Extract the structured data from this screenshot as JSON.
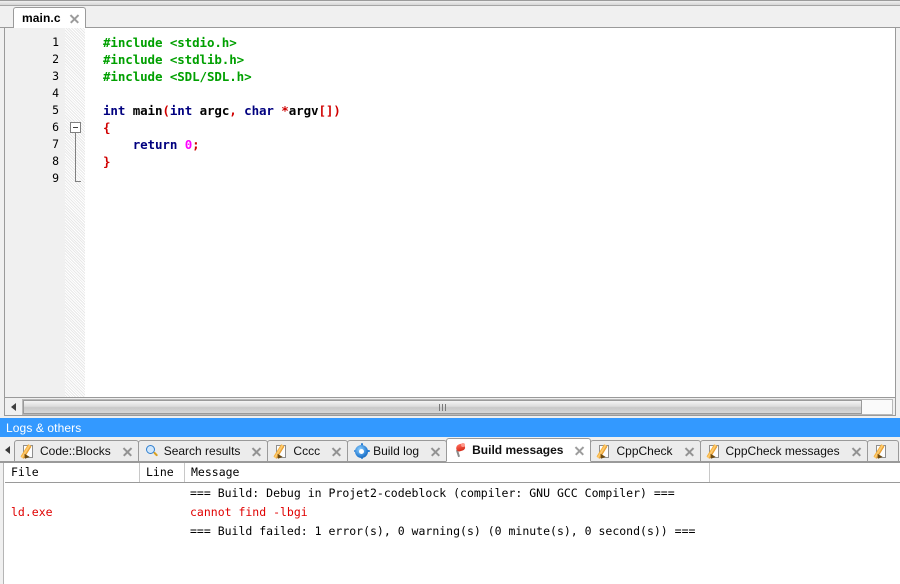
{
  "window": {
    "app_name": "Code::Blocks",
    "toolbar_region": "toolbar-strip"
  },
  "editor": {
    "tabs": [
      {
        "label": "main.c",
        "active": true,
        "close_icon": "close-icon"
      }
    ],
    "line_numbers": [
      "1",
      "2",
      "3",
      "4",
      "5",
      "6",
      "7",
      "8",
      "9"
    ],
    "fold_marker_line": 6,
    "code_lines": [
      {
        "n": 1,
        "tokens": [
          {
            "t": "#include <stdio.h>",
            "c": "pre"
          }
        ]
      },
      {
        "n": 2,
        "tokens": [
          {
            "t": "#include <stdlib.h>",
            "c": "pre"
          }
        ]
      },
      {
        "n": 3,
        "tokens": [
          {
            "t": "#include <SDL/SDL.h>",
            "c": "pre"
          }
        ]
      },
      {
        "n": 4,
        "tokens": []
      },
      {
        "n": 5,
        "tokens": [
          {
            "t": "int",
            "c": "kw"
          },
          {
            "t": " main",
            "c": "id"
          },
          {
            "t": "(",
            "c": "op"
          },
          {
            "t": "int",
            "c": "kw"
          },
          {
            "t": " argc",
            "c": "id"
          },
          {
            "t": ",",
            "c": "op"
          },
          {
            "t": " ",
            "c": "id"
          },
          {
            "t": "char",
            "c": "kw"
          },
          {
            "t": " ",
            "c": "id"
          },
          {
            "t": "*",
            "c": "op"
          },
          {
            "t": "argv",
            "c": "id"
          },
          {
            "t": "[])",
            "c": "op"
          }
        ]
      },
      {
        "n": 6,
        "tokens": [
          {
            "t": "{",
            "c": "op"
          }
        ]
      },
      {
        "n": 7,
        "tokens": [
          {
            "t": "    ",
            "c": "id"
          },
          {
            "t": "return",
            "c": "kw"
          },
          {
            "t": " ",
            "c": "id"
          },
          {
            "t": "0",
            "c": "num"
          },
          {
            "t": ";",
            "c": "op"
          }
        ]
      },
      {
        "n": 8,
        "tokens": [
          {
            "t": "}",
            "c": "op"
          }
        ]
      },
      {
        "n": 9,
        "tokens": []
      }
    ],
    "scrollbar": {
      "left_arrow_icon": "arrow-left-icon",
      "grip_icon": "scroll-grip-icon"
    }
  },
  "logs_pane": {
    "title": "Logs & others",
    "scroll_left_icon": "arrow-left-icon",
    "tabs": [
      {
        "label": "Code::Blocks",
        "icon": "pencil-icon",
        "active": false
      },
      {
        "label": "Search results",
        "icon": "search-icon",
        "active": false
      },
      {
        "label": "Cccc",
        "icon": "pencil-icon",
        "active": false
      },
      {
        "label": "Build log",
        "icon": "gear-icon",
        "active": false
      },
      {
        "label": "Build messages",
        "icon": "pin-icon",
        "active": true
      },
      {
        "label": "CppCheck",
        "icon": "pencil-icon",
        "active": false
      },
      {
        "label": "CppCheck messages",
        "icon": "pencil-icon",
        "active": false
      },
      {
        "label": "",
        "icon": "pencil-icon",
        "active": false
      }
    ]
  },
  "messages_grid": {
    "columns": [
      "File",
      "Line",
      "Message"
    ],
    "rows": [
      {
        "file": "",
        "line": "",
        "message": "=== Build: Debug in Projet2-codeblock (compiler: GNU GCC Compiler) ===",
        "severity": "normal"
      },
      {
        "file": "ld.exe",
        "line": "",
        "message": "cannot find -lbgi",
        "severity": "error"
      },
      {
        "file": "",
        "line": "",
        "message": "=== Build failed: 1 error(s), 0 warning(s) (0 minute(s), 0 second(s)) ===",
        "severity": "normal"
      }
    ]
  },
  "colors": {
    "accent_blue": "#3399ff",
    "error_red": "#e00000",
    "preprocessor_green": "#00a000",
    "keyword_navy": "#00007f",
    "operator_red": "#d00000",
    "number_magenta": "#ff00ff"
  }
}
